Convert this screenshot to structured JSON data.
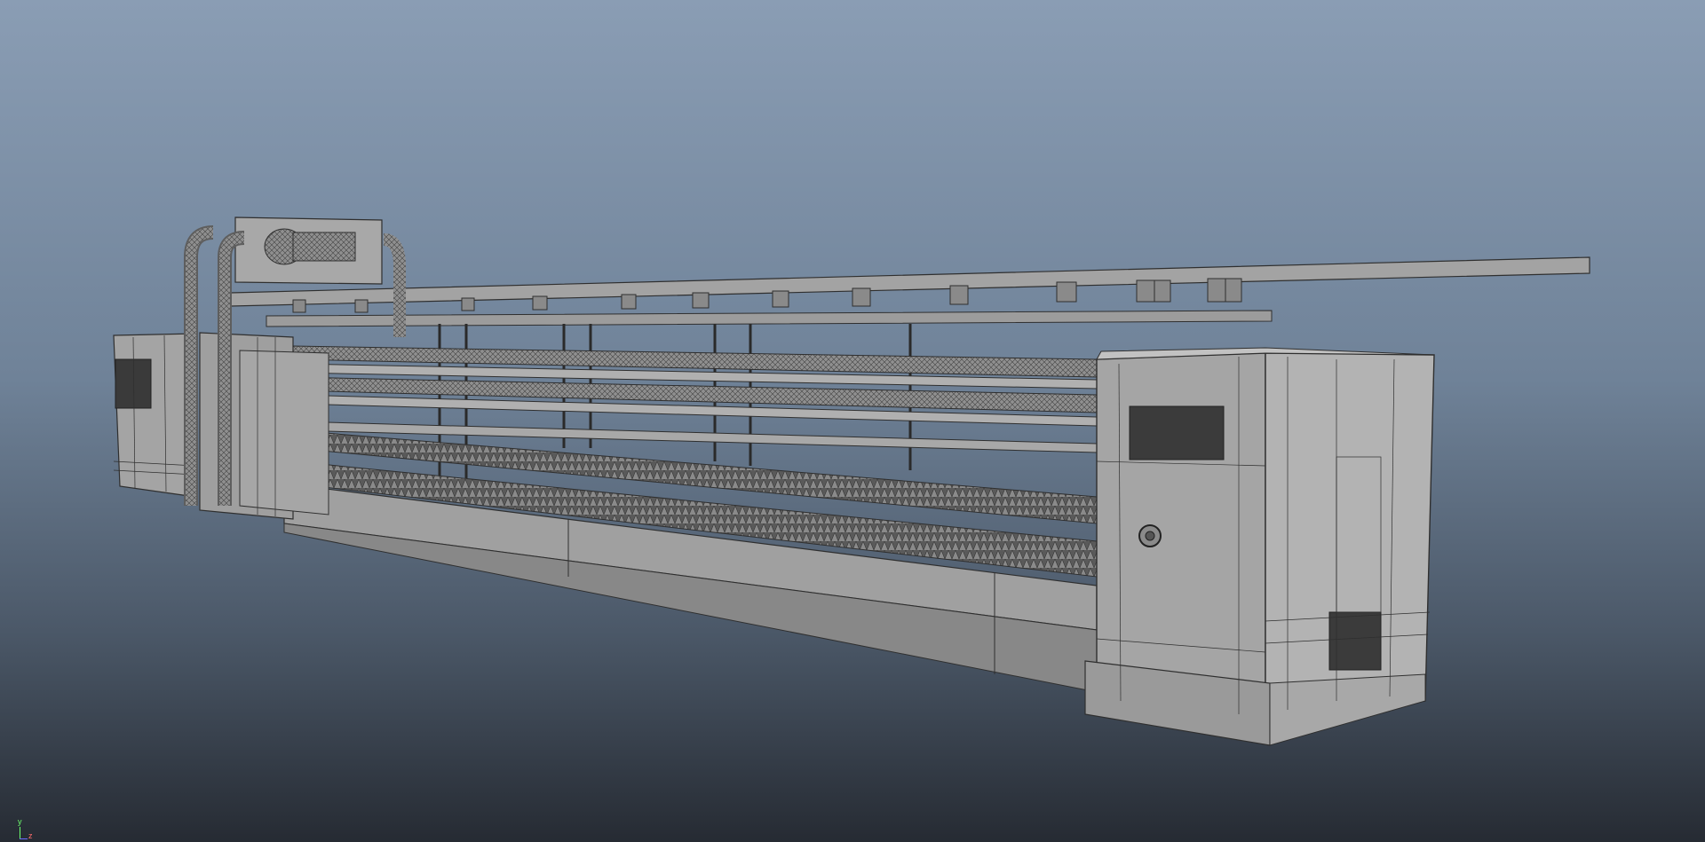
{
  "viewport": {
    "background_top": "#8a9db4",
    "background_bottom": "#262b33",
    "wireframe_color": "#2f2f2f",
    "surface_color": "#9a9a9a"
  },
  "axis_gizmo": {
    "y_label": "y",
    "z_label": "z",
    "y_color": "#6dff6d",
    "z_color": "#ff6b6b"
  }
}
